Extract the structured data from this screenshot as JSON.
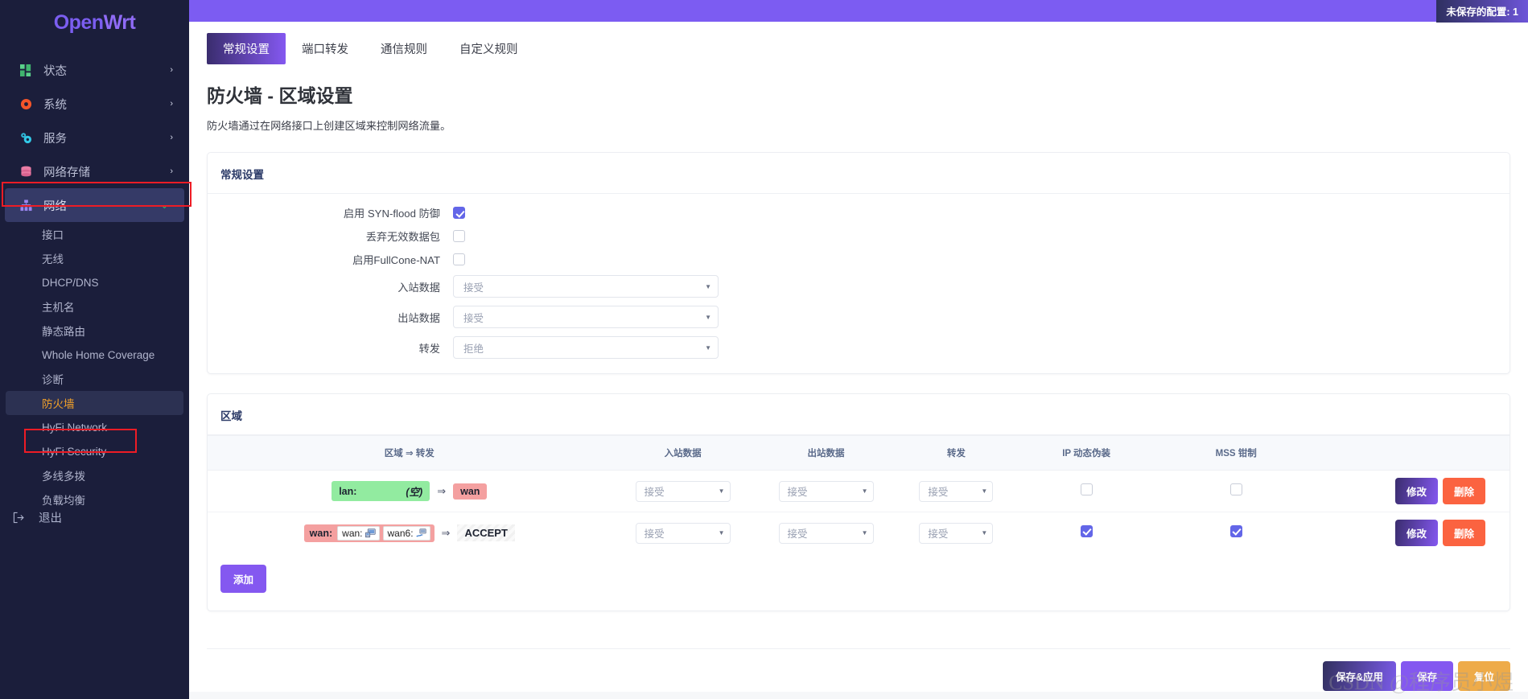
{
  "brand": {
    "name_open": "Open",
    "name_wrt": "Wrt"
  },
  "topbar": {
    "unsaved_label": "未保存的配置: 1"
  },
  "sidebar": {
    "items": [
      {
        "label": "状态",
        "icon": "status-icon",
        "chevron": "›"
      },
      {
        "label": "系统",
        "icon": "gear-icon",
        "chevron": "›"
      },
      {
        "label": "服务",
        "icon": "services-icon",
        "chevron": "›"
      },
      {
        "label": "网络存储",
        "icon": "storage-icon",
        "chevron": "›"
      },
      {
        "label": "网络",
        "icon": "network-icon",
        "chevron": "⌄"
      }
    ],
    "sub_items": [
      {
        "label": "接口"
      },
      {
        "label": "无线"
      },
      {
        "label": "DHCP/DNS"
      },
      {
        "label": "主机名"
      },
      {
        "label": "静态路由"
      },
      {
        "label": "Whole Home Coverage"
      },
      {
        "label": "诊断"
      },
      {
        "label": "防火墙"
      },
      {
        "label": "HyFi Network"
      },
      {
        "label": "HyFi Security"
      },
      {
        "label": "多线多拨"
      },
      {
        "label": "负载均衡"
      }
    ],
    "logout": {
      "label": "退出",
      "icon": "logout-icon"
    }
  },
  "tabs": [
    {
      "label": "常规设置",
      "active": true
    },
    {
      "label": "端口转发",
      "active": false
    },
    {
      "label": "通信规则",
      "active": false
    },
    {
      "label": "自定义规则",
      "active": false
    }
  ],
  "page": {
    "title": "防火墙 - 区域设置",
    "description": "防火墙通过在网络接口上创建区域来控制网络流量。"
  },
  "general": {
    "card_title": "常规设置",
    "rows": [
      {
        "label": "启用 SYN-flood 防御",
        "type": "checkbox",
        "checked": true
      },
      {
        "label": "丢弃无效数据包",
        "type": "checkbox",
        "checked": false
      },
      {
        "label": "启用FullCone-NAT",
        "type": "checkbox",
        "checked": false
      },
      {
        "label": "入站数据",
        "type": "select",
        "value": "接受"
      },
      {
        "label": "出站数据",
        "type": "select",
        "value": "接受"
      },
      {
        "label": "转发",
        "type": "select",
        "value": "拒绝"
      }
    ]
  },
  "zones": {
    "card_title": "区域",
    "columns": [
      "区域 ⇒ 转发",
      "入站数据",
      "出站数据",
      "转发",
      "IP 动态伪装",
      "MSS 钳制",
      ""
    ],
    "rows": [
      {
        "zone_name": "lan:",
        "zone_style": "green",
        "interfaces": [],
        "empty_label": "(空)",
        "target_name": "wan",
        "target_style": "red",
        "arrow": "⇒",
        "input": "接受",
        "output": "接受",
        "forward": "接受",
        "masq": false,
        "mtu_fix": false,
        "edit_label": "修改",
        "delete_label": "删除"
      },
      {
        "zone_name": "wan:",
        "zone_style": "red",
        "interfaces": [
          {
            "label": "wan:",
            "icon": "ethernet-icon"
          },
          {
            "label": "wan6:",
            "icon": "tunnel-icon"
          }
        ],
        "empty_label": "",
        "target_name": "ACCEPT",
        "target_style": "hatched",
        "arrow": "⇒",
        "input": "接受",
        "output": "接受",
        "forward": "接受",
        "masq": true,
        "mtu_fix": true,
        "edit_label": "修改",
        "delete_label": "删除"
      }
    ],
    "add_label": "添加"
  },
  "footer": {
    "save_apply_label": "保存&应用",
    "save_label": "保存",
    "reset_label": "复位"
  },
  "watermark": "CSDN @程序员小煜"
}
